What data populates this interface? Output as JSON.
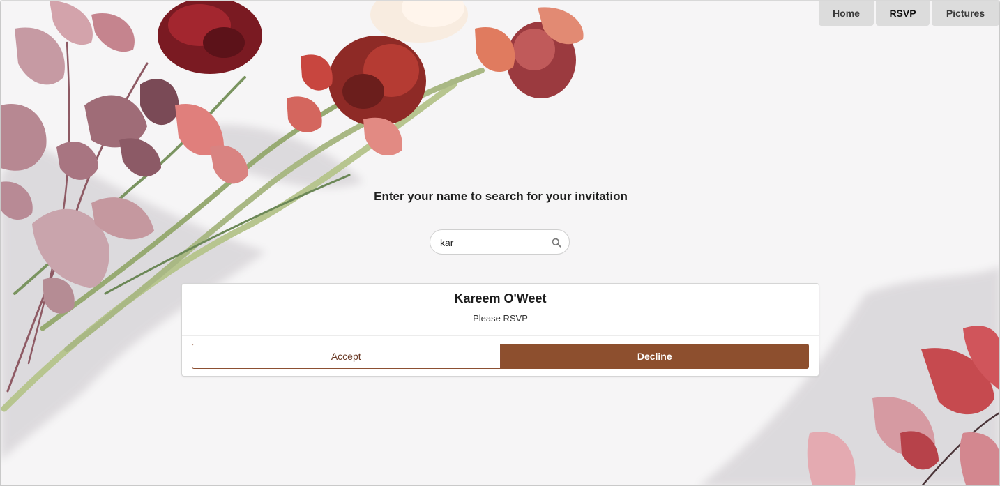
{
  "nav": {
    "items": [
      {
        "label": "Home"
      },
      {
        "label": "RSVP"
      },
      {
        "label": "Pictures"
      }
    ]
  },
  "search": {
    "prompt": "Enter your name to search for your invitation",
    "value": "kar",
    "icon": "search-icon"
  },
  "result": {
    "name": "Kareem O'Weet",
    "status": "Please RSVP",
    "accept_label": "Accept",
    "decline_label": "Decline"
  },
  "colors": {
    "accent": "#8d4f2e",
    "nav_bg": "#dcdcdc"
  }
}
